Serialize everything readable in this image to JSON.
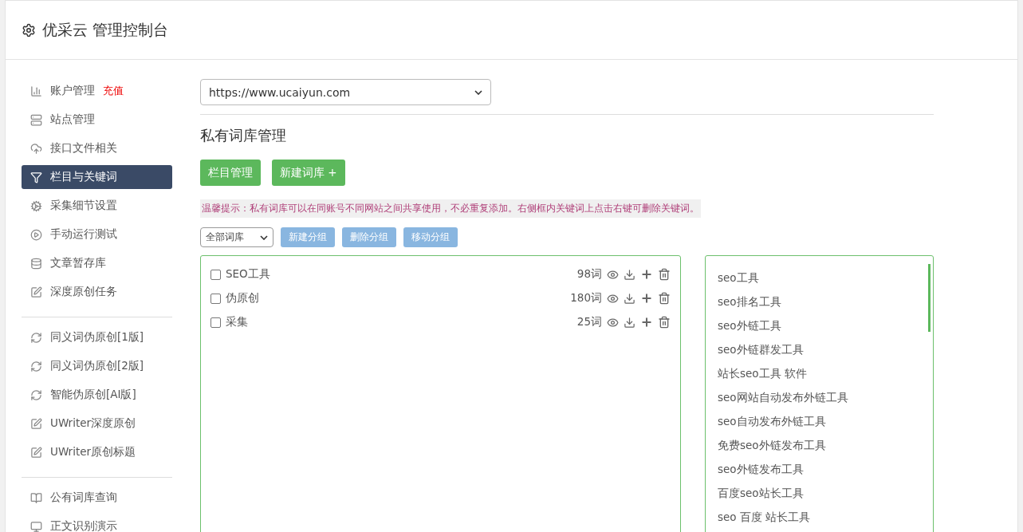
{
  "header": {
    "title": "优采云 管理控制台"
  },
  "sidebar": {
    "groups": [
      [
        {
          "label": "账户管理",
          "badge": "充值",
          "selected": false
        },
        {
          "label": "站点管理",
          "selected": false
        },
        {
          "label": "接口文件相关",
          "selected": false
        },
        {
          "label": "栏目与关键词",
          "selected": true
        },
        {
          "label": "采集细节设置",
          "selected": false
        },
        {
          "label": "手动运行测试",
          "selected": false
        },
        {
          "label": "文章暂存库",
          "selected": false
        },
        {
          "label": "深度原创任务",
          "selected": false
        }
      ],
      [
        {
          "label": "同义词伪原创[1版]",
          "selected": false
        },
        {
          "label": "同义词伪原创[2版]",
          "selected": false
        },
        {
          "label": "智能伪原创[AI版]",
          "selected": false
        },
        {
          "label": "UWriter深度原创",
          "selected": false
        },
        {
          "label": "UWriter原创标题",
          "selected": false
        }
      ],
      [
        {
          "label": "公有词库查询",
          "selected": false
        },
        {
          "label": "正文识别演示",
          "selected": false
        }
      ]
    ]
  },
  "site_select": {
    "value": "https://www.ucaiyun.com"
  },
  "heading": "私有词库管理",
  "tabs": [
    {
      "label": "栏目管理",
      "selected": false
    },
    {
      "label": "新建词库 +",
      "selected": false
    }
  ],
  "tip": "温馨提示：私有词库可以在同账号不同网站之间共享使用，不必重复添加。右侧框内关键词上点击右键可删除关键词。",
  "library_select": {
    "value": "全部词库"
  },
  "group_buttons": [
    "新建分组",
    "删除分组",
    "移动分组"
  ],
  "libraries": [
    {
      "name": "SEO工具",
      "count": "98词",
      "checked": false
    },
    {
      "name": "伪原创",
      "count": "180词",
      "checked": false
    },
    {
      "name": "采集",
      "count": "25词",
      "checked": false
    }
  ],
  "keywords": [
    "seo工具",
    "seo排名工具",
    "seo外链工具",
    "seo外链群发工具",
    "站长seo工具 软件",
    "seo网站自动发布外链工具",
    "seo自动发布外链工具",
    "免费seo外链发布工具",
    "seo外链发布工具",
    "百度seo站长工具",
    "seo 百度 站长工具"
  ]
}
